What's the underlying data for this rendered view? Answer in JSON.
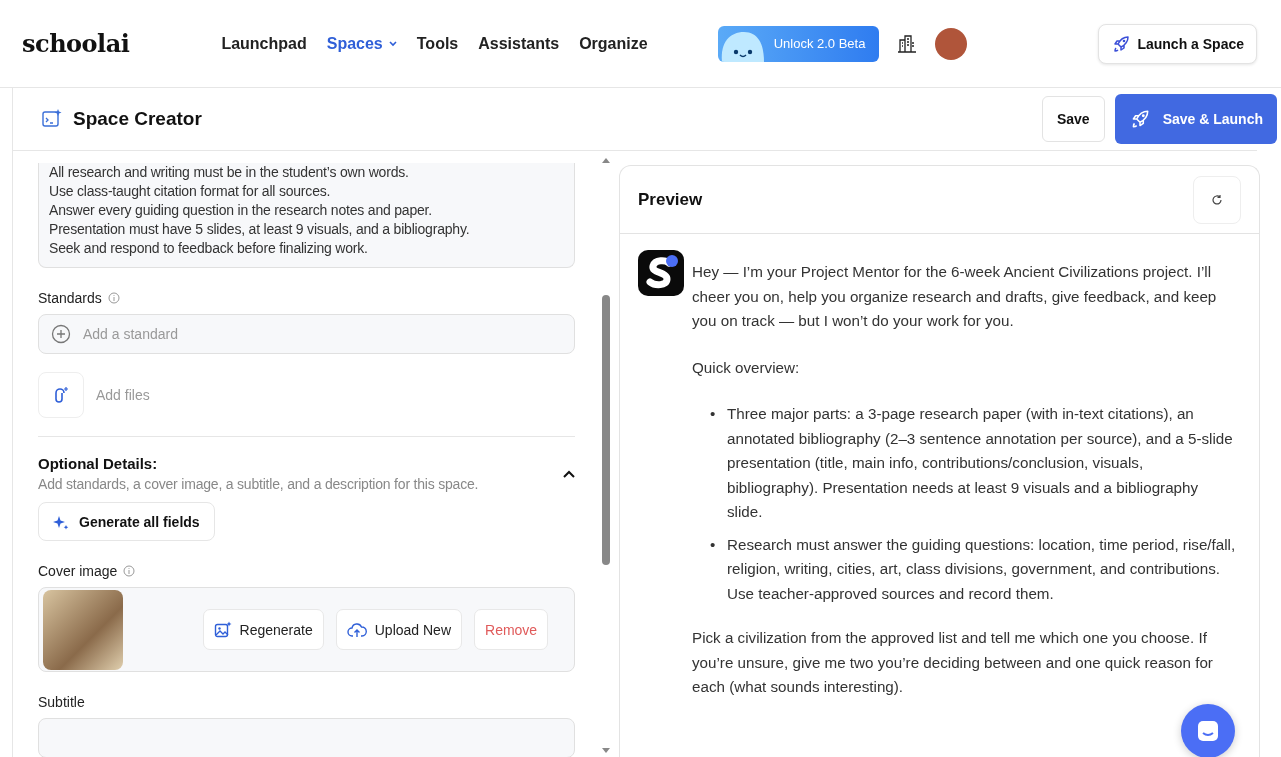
{
  "header": {
    "logo": "schoolai",
    "nav": [
      {
        "label": "Launchpad",
        "selected": false,
        "dropdown": false
      },
      {
        "label": "Spaces",
        "selected": true,
        "dropdown": true
      },
      {
        "label": "Tools",
        "selected": false,
        "dropdown": false
      },
      {
        "label": "Assistants",
        "selected": false,
        "dropdown": false
      },
      {
        "label": "Organize",
        "selected": false,
        "dropdown": false
      }
    ],
    "unlock_button": "Unlock 2.0 Beta",
    "launch_button": "Launch a Space"
  },
  "toolbar": {
    "title": "Space Creator",
    "save": "Save",
    "save_launch": "Save & Launch"
  },
  "editor": {
    "rules_lines": [
      "All research and writing must be in the student’s own words.",
      "Use class-taught citation format for all sources.",
      "Answer every guiding question in the research notes and paper.",
      "Presentation must have 5 slides, at least 9 visuals, and a bibliography.",
      "Seek and respond to feedback before finalizing work."
    ],
    "standards_label": "Standards",
    "standard_placeholder": "Add a standard",
    "add_files": "Add files",
    "optional_title": "Optional Details:",
    "optional_desc": "Add standards, a cover image, a subtitle, and a description for this space.",
    "optional_expanded": true,
    "generate": "Generate all fields",
    "cover_label": "Cover image",
    "regenerate": "Regenerate",
    "upload": "Upload New",
    "remove": "Remove",
    "subtitle_label": "Subtitle"
  },
  "preview": {
    "title": "Preview",
    "messages": [
      {
        "kind": "paragraph",
        "text": "Hey — I’m your Project Mentor for the 6-week Ancient Civilizations project. I’ll cheer you on, help you organize research and drafts, give feedback, and keep you on track — but I won’t do your work for you."
      },
      {
        "kind": "paragraph",
        "text": "Quick overview:"
      },
      {
        "kind": "bullets",
        "marker": "•",
        "items": [
          "Three major parts: a 3-page research paper (with in-text citations), an annotated bibliography (2–3 sentence annotation per source), and a 5-slide presentation (title, main info, contributions/conclusion, visuals, bibliography). Presentation needs at least 9 visuals and a bibliography slide.",
          "Research must answer the guiding questions: location, time period, rise/fall, religion, writing, cities, art, class divisions, government, and contributions. Use teacher-approved sources and record them."
        ]
      },
      {
        "kind": "paragraph",
        "text": "Pick a civilization from the approved list and tell me which one you choose. If you’re unsure, give me two you’re deciding between and one quick reason for each (what sounds interesting)."
      }
    ]
  }
}
